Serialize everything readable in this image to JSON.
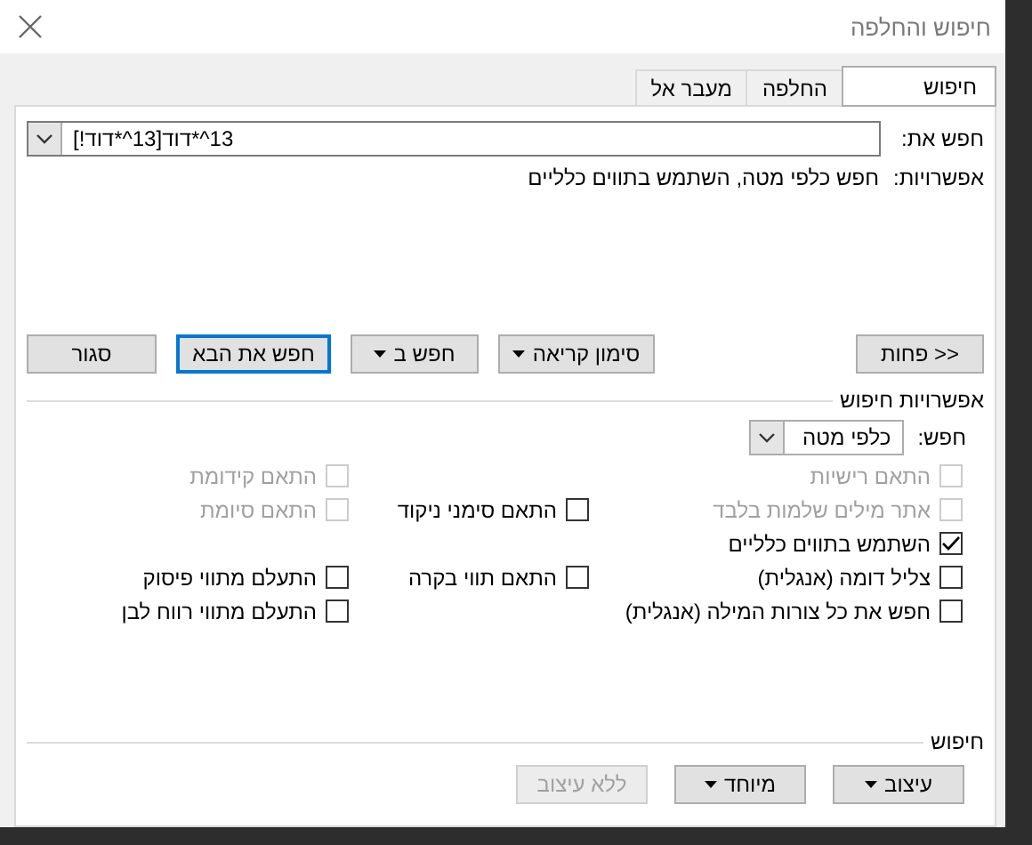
{
  "window": {
    "title": "חיפוש והחלפה"
  },
  "tabs": [
    {
      "label": "חיפוש",
      "selected": true
    },
    {
      "label": "החלפה",
      "selected": false
    },
    {
      "label": "מעבר אל",
      "selected": false
    }
  ],
  "find": {
    "label": "חפש את:",
    "value": "[!דוד*^13]דוד*^13"
  },
  "options": {
    "label": "אפשרויות:",
    "value": "חפש כלפי מטה, השתמש בתווים כלליים"
  },
  "less_button": "<< פחות",
  "buttons": [
    {
      "label": "סימון קריאה",
      "dropdown": true,
      "default": false
    },
    {
      "label": "חפש ב",
      "dropdown": true,
      "default": false
    },
    {
      "label": "חפש את הבא",
      "dropdown": false,
      "default": true
    },
    {
      "label": "סגור",
      "dropdown": false,
      "default": false
    }
  ],
  "search_options": {
    "title": "אפשרויות חיפוש",
    "direction_label": "חפש:",
    "direction_value": "כלפי מטה",
    "rows": [
      [
        {
          "label": "התאם רישיות",
          "checked": false,
          "disabled": true
        },
        null,
        {
          "label": "התאם קידומת",
          "checked": false,
          "disabled": true
        }
      ],
      [
        {
          "label": "אתר מילים שלמות בלבד",
          "checked": false,
          "disabled": true
        },
        {
          "label": "התאם סימני ניקוד",
          "checked": false,
          "disabled": false
        },
        {
          "label": "התאם סיומת",
          "checked": false,
          "disabled": true
        }
      ],
      [
        {
          "label": "השתמש בתווים כלליים",
          "checked": true,
          "disabled": false
        },
        null,
        null
      ],
      [
        {
          "label": "צליל דומה (אנגלית)",
          "checked": false,
          "disabled": false
        },
        {
          "label": "התאם תווי בקרה",
          "checked": false,
          "disabled": false
        },
        {
          "label": "התעלם מתווי פיסוק",
          "checked": false,
          "disabled": false
        }
      ],
      [
        {
          "label": "חפש את כל צורות המילה (אנגלית)",
          "checked": false,
          "disabled": false
        },
        null,
        {
          "label": "התעלם מתווי רווח לבן",
          "checked": false,
          "disabled": false
        }
      ]
    ]
  },
  "find_group": {
    "title": "חיפוש",
    "buttons": [
      {
        "label": "עיצוב",
        "dropdown": true,
        "disabled": false
      },
      {
        "label": "מיוחד",
        "dropdown": true,
        "disabled": false
      },
      {
        "label": "ללא עיצוב",
        "dropdown": false,
        "disabled": true
      }
    ]
  }
}
